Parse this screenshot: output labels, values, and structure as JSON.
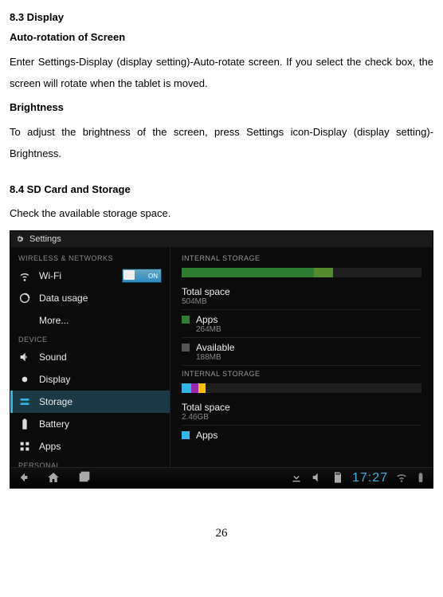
{
  "doc": {
    "sec83_title": "8.3 Display",
    "autorotate_heading": "Auto-rotation of Screen",
    "autorotate_body": "Enter Settings-Display (display setting)-Auto-rotate screen. If you select the check box, the screen will rotate when the tablet is moved.",
    "brightness_heading": "Brightness",
    "brightness_body": "To adjust the brightness of the screen, press Settings icon-Display (display setting)-Brightness.",
    "sec84_title": "8.4 SD Card and Storage",
    "sec84_body": "Check the available storage space.",
    "page_number": "26"
  },
  "screenshot": {
    "statusbar_title": "Settings",
    "categories": {
      "wireless": "WIRELESS & NETWORKS",
      "device": "DEVICE",
      "personal": "PERSONAL"
    },
    "left_items": {
      "wifi": "Wi-Fi",
      "wifi_toggle": "ON",
      "datausage": "Data usage",
      "more": "More...",
      "sound": "Sound",
      "display": "Display",
      "storage": "Storage",
      "battery": "Battery",
      "apps": "Apps"
    },
    "right": {
      "header1": "INTERNAL STORAGE",
      "total_space": "Total space",
      "total_space_val": "504MB",
      "apps": "Apps",
      "apps_val": "264MB",
      "available": "Available",
      "available_val": "188MB",
      "header2": "INTERNAL STORAGE",
      "total_space2": "Total space",
      "total_space2_val": "2.46GB",
      "partial": "Apps"
    },
    "navbar": {
      "clock": "17:27"
    }
  }
}
